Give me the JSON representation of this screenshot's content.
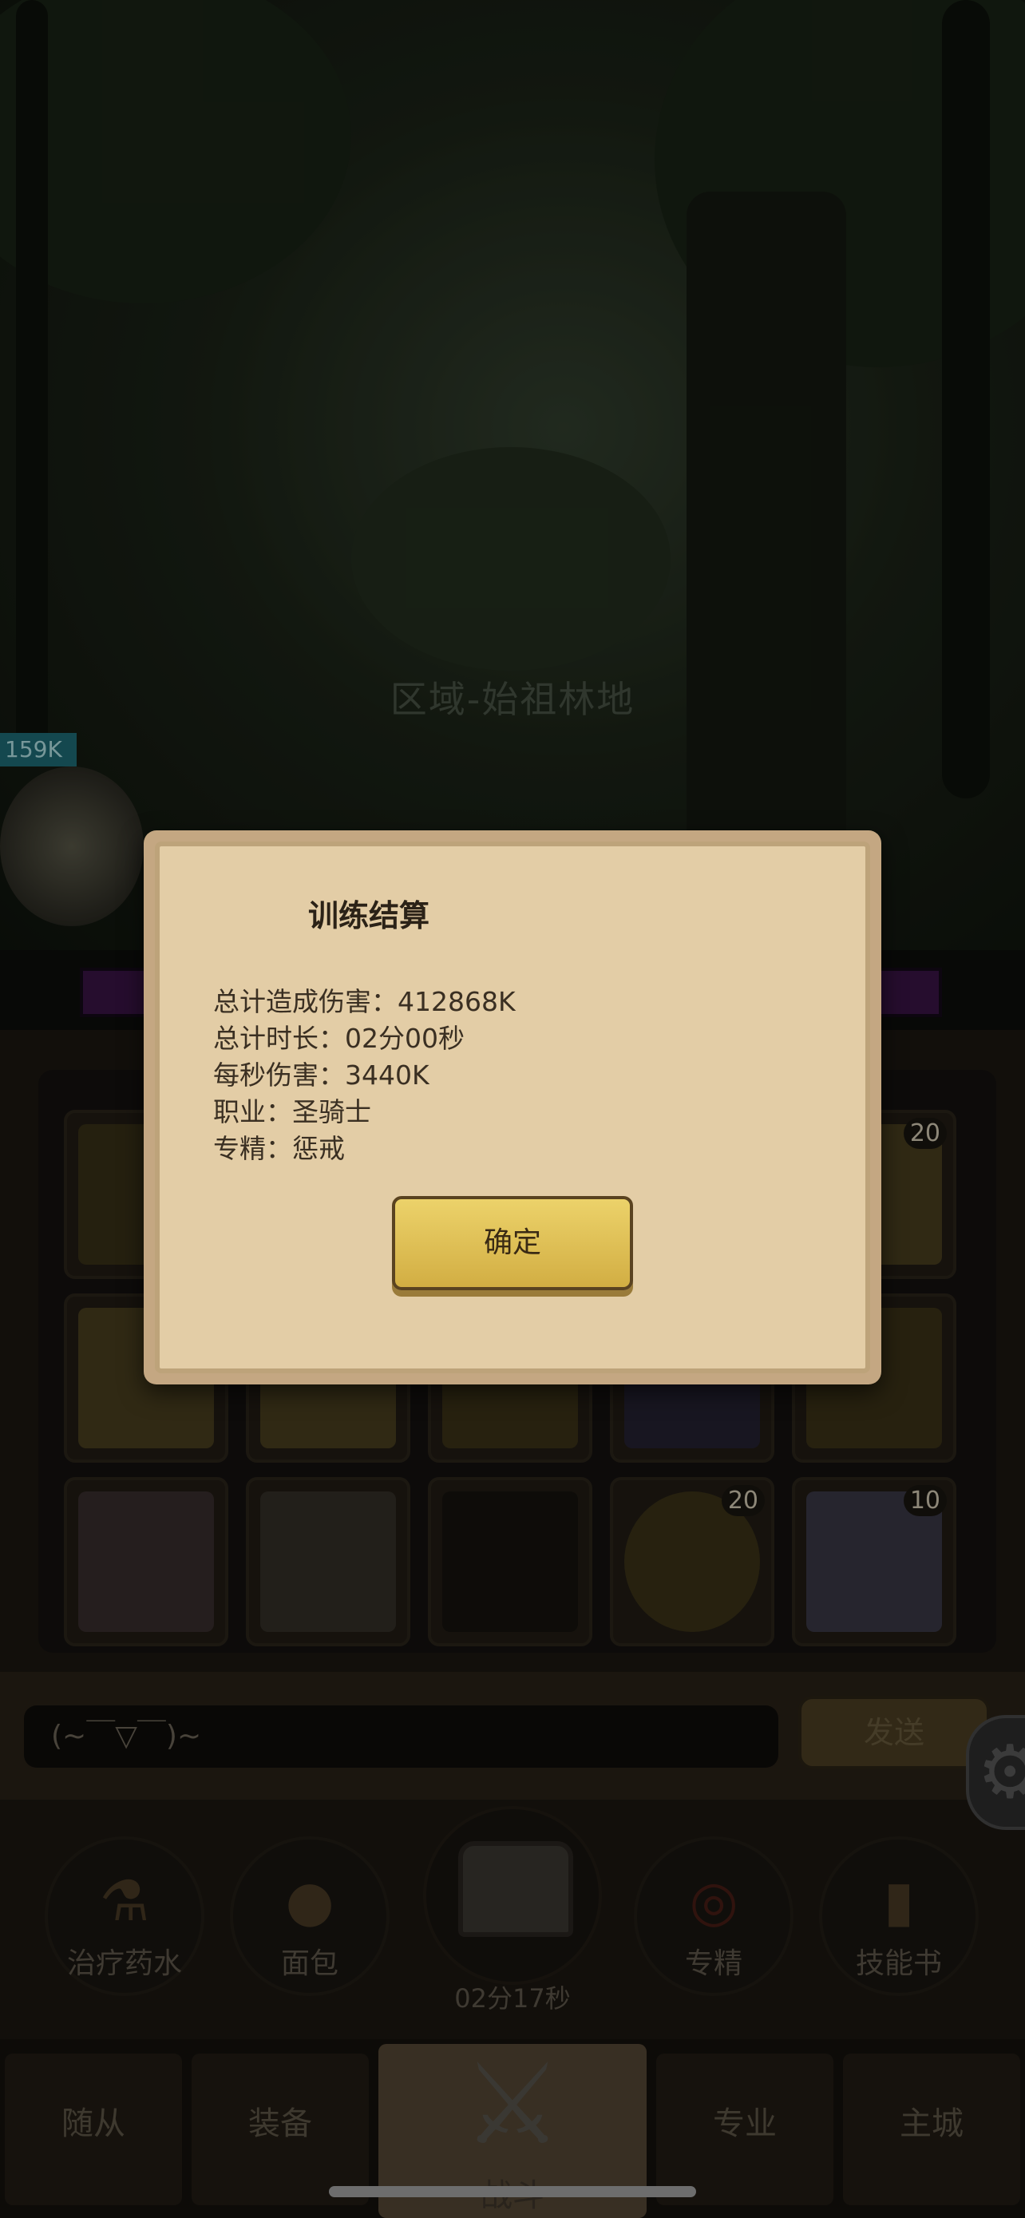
{
  "scene": {
    "zone": "区域-始祖林地",
    "hero_hp": "159K"
  },
  "inventory": {
    "slots": [
      {
        "count": ""
      },
      {
        "count": ""
      },
      {
        "count": ""
      },
      {
        "count": ""
      },
      {
        "count": "20"
      },
      {
        "count": ""
      },
      {
        "count": ""
      },
      {
        "count": ""
      },
      {
        "count": ""
      },
      {
        "count": ""
      },
      {
        "count": ""
      },
      {
        "count": ""
      },
      {
        "count": ""
      },
      {
        "count": "20"
      },
      {
        "count": "10"
      }
    ]
  },
  "chat": {
    "placeholder": "(~￣▽￣)~",
    "send_label": "发送"
  },
  "quick_items": {
    "potion": "治疗药水",
    "bread": "面包",
    "chest_timer": "02分17秒",
    "specialization": "专精",
    "skill_book": "技能书"
  },
  "tabs": {
    "followers": "随从",
    "equipment": "装备",
    "battle": "战斗",
    "profession": "专业",
    "main_city": "主城"
  },
  "dialog": {
    "title": "训练结算",
    "total_damage": "总计造成伤害：412868K",
    "total_time": "总计时长：02分00秒",
    "dps": "每秒伤害：3440K",
    "class": "职业：圣骑士",
    "spec": "专精：惩戒",
    "confirm_label": "确定"
  },
  "colors": {
    "dialog_paper": "#e3cda6",
    "confirm_button": "#e0c055",
    "background": "#1c1812"
  }
}
